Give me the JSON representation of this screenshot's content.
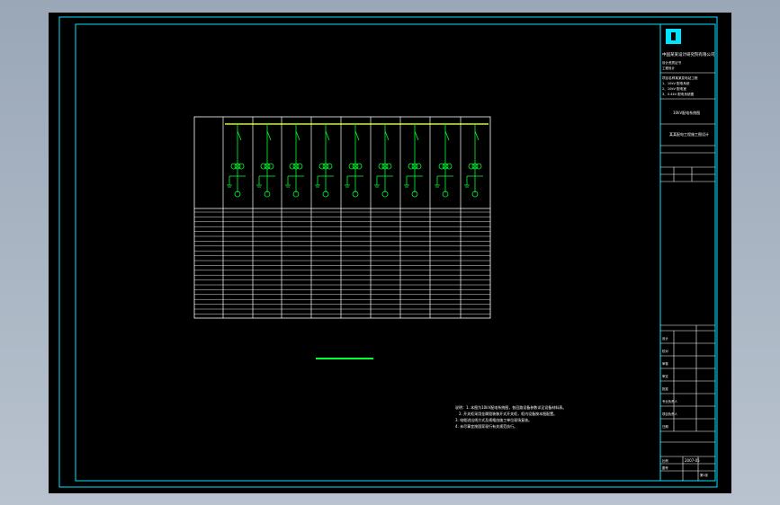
{
  "title_block": {
    "company_name": "中国某某设计研究院有限公司",
    "company_sub1": "设计资质证书",
    "company_sub2": "工程设计",
    "project_label1": "项目名称某某变电站工程",
    "project_label2": "1、10kV 配电系统",
    "project_label3": "2、10kV 配电室",
    "project_label4": "3、0.4kV 配电系统图",
    "drawing_title": "10kV配电系统图",
    "subtitle": "某某配电工程施工图设计",
    "row_labels": [
      "设计",
      "校对",
      "审核",
      "审定",
      "批准",
      "专业负责人",
      "项目负责人",
      "日期"
    ],
    "scale_label": "比例",
    "sheet_label": "图号",
    "drawing_number": "2007-05",
    "page_label": "第1张"
  },
  "notes": [
    "说明：1. 本图为10kV配电系统图，各回路设备参数详见设备材料表。",
    "2. 开关柜采用金属铠装移开式开关柜，柜内设备按本图配置。",
    "3. 电缆进出线方式及规格由施工单位现场复核。",
    "4. 未尽事宜按国家现行有关规范执行。"
  ],
  "colors": {
    "frame": "#00e5ff",
    "lines": "#ffffff",
    "busbar": "#c8ff00",
    "equipment": "#00ff33",
    "logo": "#00e5ff"
  }
}
